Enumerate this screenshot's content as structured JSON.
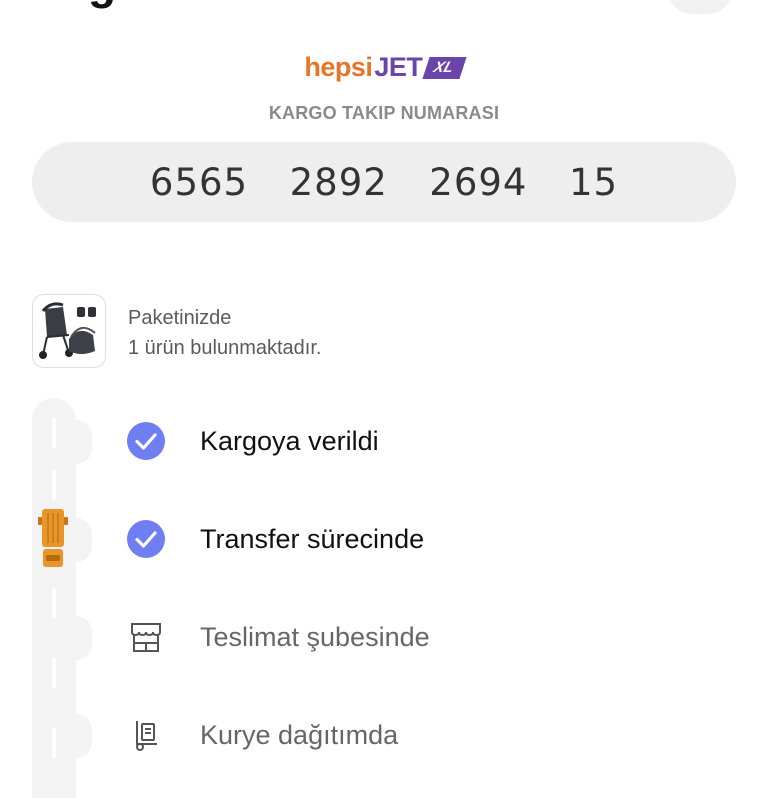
{
  "header": {
    "title_fragment": "g"
  },
  "brand": {
    "logo_hepsi": "hepsi",
    "logo_jet": "JET",
    "logo_xl": "XL"
  },
  "tracking": {
    "label": "KARGO TAKIP NUMARASI",
    "number": "6565  2892  2694  15"
  },
  "package": {
    "line1": "Paketinizde",
    "line2": "1 ürün bulunmaktadır."
  },
  "steps": [
    {
      "label": "Kargoya verildi",
      "status": "done",
      "icon": "check-circle-icon"
    },
    {
      "label": "Transfer sürecinde",
      "status": "done",
      "icon": "check-circle-icon"
    },
    {
      "label": "Teslimat şubesinde",
      "status": "pending",
      "icon": "store-icon"
    },
    {
      "label": "Kurye dağıtımda",
      "status": "pending",
      "icon": "courier-icon"
    }
  ],
  "colors": {
    "accent_check": "#6f7ef0",
    "brand_orange": "#e8742a",
    "brand_purple": "#6a44a8",
    "truck": "#e8962a"
  }
}
